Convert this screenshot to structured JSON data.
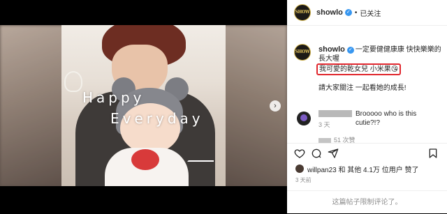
{
  "header": {
    "avatar_text": "SHOW",
    "username": "showlo",
    "verified_mark": "✓",
    "separator": "•",
    "follow_status": "已关注"
  },
  "media": {
    "overlay_line1": "Happy",
    "overlay_line2": "Everyday",
    "next_arrow": "›",
    "mute_icon": "🔇",
    "carousel_count": 4,
    "carousel_active": 0
  },
  "caption": {
    "avatar_text": "SHOW",
    "username": "showlo",
    "line1": "一定要健健康康 快快樂樂的長大喔",
    "highlight": "我可愛的乾女兒 小米果😘",
    "line3": "請大家關注 一起看她的成長!",
    "time": "3 天"
  },
  "comment": {
    "text": "Brooooo who is this cutie?!?",
    "meta": "51 次赞"
  },
  "likes": {
    "text": "willpan23 和 其他 4.1万 位用户 赞了"
  },
  "post_time": "3 天前",
  "comments_disabled": "这篇帖子限制评论了。",
  "colors": {
    "verified": "#3897f0",
    "highlight_border": "#e0262d",
    "carousel_active": "#2d8fed"
  }
}
